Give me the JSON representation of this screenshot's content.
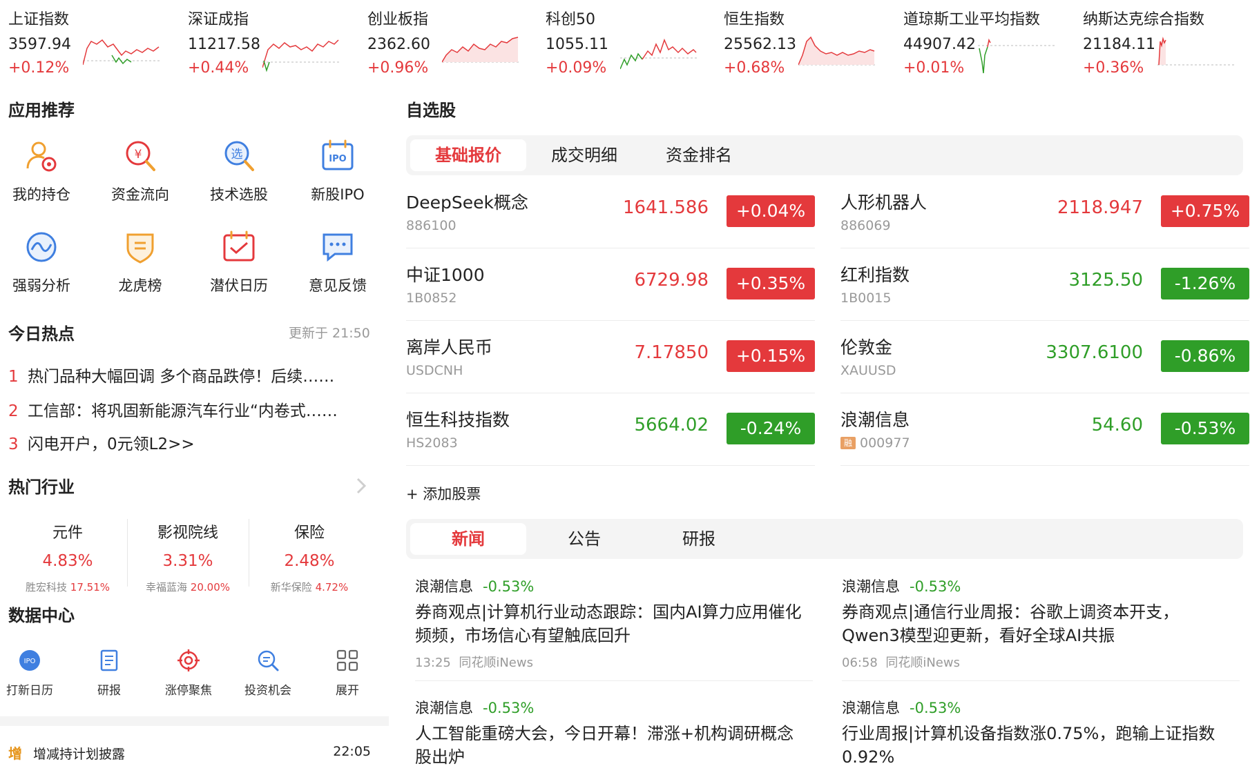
{
  "indices": [
    {
      "name": "上证指数",
      "value": "3597.94",
      "change": "+0.12%"
    },
    {
      "name": "深证成指",
      "value": "11217.58",
      "change": "+0.44%"
    },
    {
      "name": "创业板指",
      "value": "2362.60",
      "change": "+0.96%"
    },
    {
      "name": "科创50",
      "value": "1055.11",
      "change": "+0.09%"
    },
    {
      "name": "恒生指数",
      "value": "25562.13",
      "change": "+0.68%"
    },
    {
      "name": "道琼斯工业平均指数",
      "value": "44907.42",
      "change": "+0.01%"
    },
    {
      "name": "纳斯达克综合指数",
      "value": "21184.11",
      "change": "+0.36%"
    }
  ],
  "apps": {
    "title": "应用推荐",
    "items": [
      {
        "label": "我的持仓",
        "icon": "portfolio-icon"
      },
      {
        "label": "资金流向",
        "icon": "money-flow-icon"
      },
      {
        "label": "技术选股",
        "icon": "stock-picker-icon"
      },
      {
        "label": "新股IPO",
        "icon": "ipo-calendar-icon"
      },
      {
        "label": "强弱分析",
        "icon": "strength-analysis-icon"
      },
      {
        "label": "龙虎榜",
        "icon": "dragon-tiger-icon"
      },
      {
        "label": "潜伏日历",
        "icon": "calendar-icon"
      },
      {
        "label": "意见反馈",
        "icon": "feedback-icon"
      }
    ]
  },
  "hot": {
    "title": "今日热点",
    "updated": "更新于 21:50",
    "items": [
      {
        "num": "1",
        "text": "热门品种大幅回调 多个商品跌停！后续……"
      },
      {
        "num": "2",
        "text": "工信部：将巩固新能源汽车行业“内卷式……"
      },
      {
        "num": "3",
        "text": "闪电开户，0元领L2>>"
      }
    ]
  },
  "industries": {
    "title": "热门行业",
    "items": [
      {
        "name": "元件",
        "pct": "4.83%",
        "leader": "胜宏科技",
        "leader_pct": "17.51%"
      },
      {
        "name": "影视院线",
        "pct": "3.31%",
        "leader": "幸福蓝海",
        "leader_pct": "20.00%"
      },
      {
        "name": "保险",
        "pct": "2.48%",
        "leader": "新华保险",
        "leader_pct": "4.72%"
      }
    ]
  },
  "data_center": {
    "title": "数据中心",
    "items": [
      {
        "label": "打新日历",
        "icon": "ipo-icon"
      },
      {
        "label": "研报",
        "icon": "report-icon"
      },
      {
        "label": "涨停聚焦",
        "icon": "target-icon"
      },
      {
        "label": "投资机会",
        "icon": "search-icon"
      },
      {
        "label": "展开",
        "icon": "grid-icon"
      }
    ],
    "ipo_badge": "IPO"
  },
  "notice": {
    "tag": "增",
    "text": "增减持计划披露",
    "time": "22:05"
  },
  "watchlist": {
    "title": "自选股",
    "tabs": [
      "基础报价",
      "成交明细",
      "资金排名"
    ],
    "stocks": [
      {
        "name": "DeepSeek概念",
        "code": "886100",
        "price": "1641.586",
        "change": "+0.04%",
        "dir": "up"
      },
      {
        "name": "人形机器人",
        "code": "886069",
        "price": "2118.947",
        "change": "+0.75%",
        "dir": "up"
      },
      {
        "name": "中证1000",
        "code": "1B0852",
        "price": "6729.98",
        "change": "+0.35%",
        "dir": "up"
      },
      {
        "name": "红利指数",
        "code": "1B0015",
        "price": "3125.50",
        "change": "-1.26%",
        "dir": "down"
      },
      {
        "name": "离岸人民币",
        "code": "USDCNH",
        "price": "7.17850",
        "change": "+0.15%",
        "dir": "up"
      },
      {
        "name": "伦敦金",
        "code": "XAUUSD",
        "price": "3307.6100",
        "change": "-0.86%",
        "dir": "down"
      },
      {
        "name": "恒生科技指数",
        "code": "HS2083",
        "price": "5664.02",
        "change": "-0.24%",
        "dir": "down"
      },
      {
        "name": "浪潮信息",
        "code": "000977",
        "price": "54.60",
        "change": "-0.53%",
        "dir": "down",
        "tag": "融"
      }
    ],
    "add_label": "+ 添加股票"
  },
  "news": {
    "tabs": [
      "新闻",
      "公告",
      "研报"
    ],
    "items": [
      {
        "stock": "浪潮信息",
        "change": "-0.53%",
        "title": "券商观点|计算机行业动态跟踪：国内AI算力应用催化频频，市场信心有望触底回升",
        "time": "13:25",
        "source": "同花顺iNews"
      },
      {
        "stock": "浪潮信息",
        "change": "-0.53%",
        "title": "券商观点|通信行业周报：谷歌上调资本开支，Qwen3模型迎更新，看好全球AI共振",
        "time": "06:58",
        "source": "同花顺iNews"
      },
      {
        "stock": "浪潮信息",
        "change": "-0.53%",
        "title": "人工智能重磅大会，今日开幕！滞涨+机构调研概念股出炉",
        "time": "",
        "source": ""
      },
      {
        "stock": "浪潮信息",
        "change": "-0.53%",
        "title": "行业周报|计算机设备指数涨0.75%，跑输上证指数0.92%",
        "time": "",
        "source": ""
      }
    ]
  },
  "colors": {
    "up": "#e4393c",
    "down": "#2f9e28",
    "accent": "#e4393c",
    "icon_orange": "#f0a030",
    "icon_blue": "#3f7fe0"
  }
}
